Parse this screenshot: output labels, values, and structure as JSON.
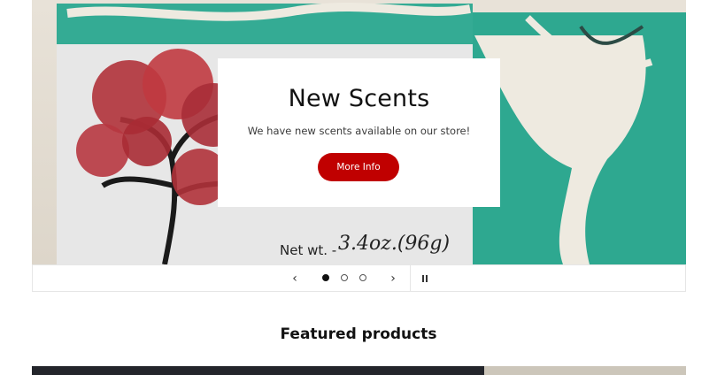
{
  "slide": {
    "heading": "New Scents",
    "text": "We have new scents available on our store!",
    "button_label": "More Info",
    "label_handwriting": "3.4oz.(96g)",
    "label_printed": "Net wt. -"
  },
  "slideshow_controls": {
    "prev_icon": "chevron-left-icon",
    "next_icon": "chevron-right-icon",
    "pause_icon": "pause-icon",
    "slide_count": 3,
    "active_slide": 1
  },
  "featured": {
    "title": "Featured products"
  },
  "colors": {
    "accent_button": "#c00000",
    "soap_teal": "#2aa28e",
    "tree_red": "#b0323a",
    "product_dark": "#23252b"
  }
}
